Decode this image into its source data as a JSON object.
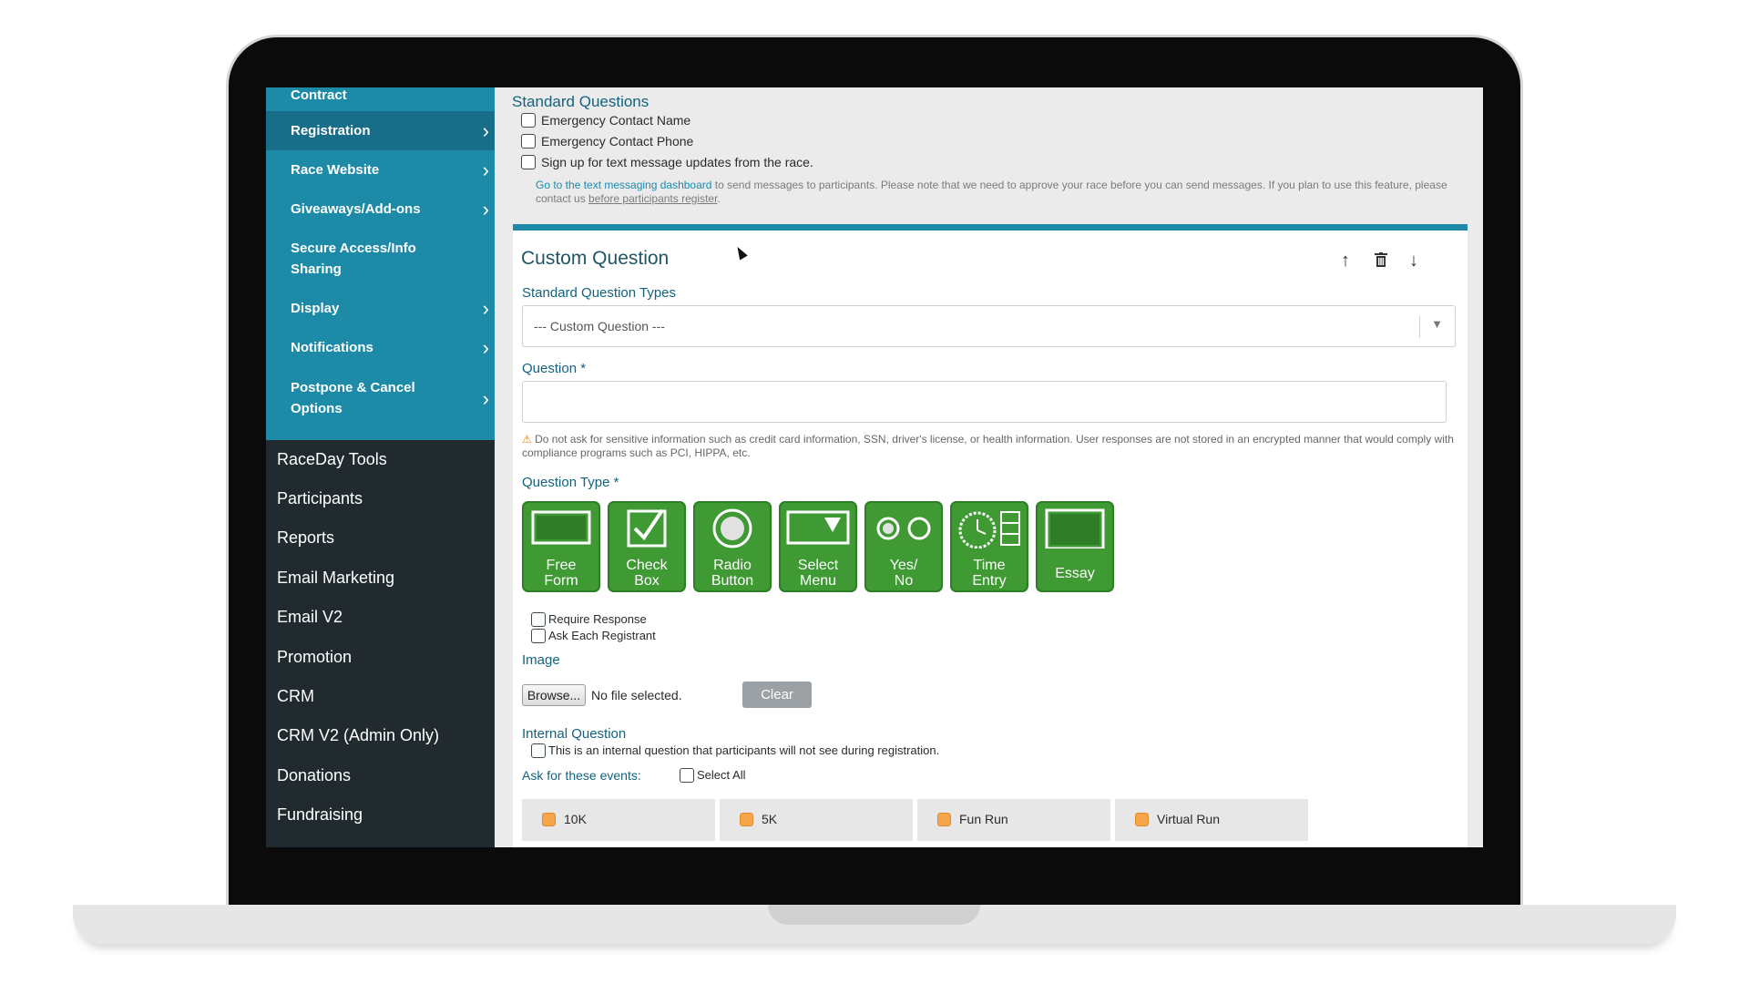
{
  "sidebar": {
    "sub_items": [
      {
        "label": "Contract",
        "chevron": false
      },
      {
        "label": "Registration",
        "chevron": true,
        "active": true
      },
      {
        "label": "Race Website",
        "chevron": true
      },
      {
        "label": "Giveaways/Add-ons",
        "chevron": true
      },
      {
        "label": "Secure Access/Info",
        "label2": "Sharing",
        "chevron": false
      },
      {
        "label": "Display",
        "chevron": true
      },
      {
        "label": "Notifications",
        "chevron": true
      },
      {
        "label": "Postpone & Cancel",
        "label2": "Options",
        "chevron": true
      }
    ],
    "chevron_glyph": "›",
    "main_items": [
      "RaceDay Tools",
      "Participants",
      "Reports",
      "Email Marketing",
      "Email V2",
      "Promotion",
      "CRM",
      "CRM V2 (Admin Only)",
      "Donations",
      "Fundraising"
    ]
  },
  "standard_questions": {
    "title": "Standard Questions",
    "items": [
      "Emergency Contact Name",
      "Emergency Contact Phone",
      "Sign up for text message updates from the race."
    ],
    "note_link": "Go to the text messaging dashboard",
    "note_text": " to send messages to participants. Please note that we need to approve your race before you can send messages. If you plan to use this feature, please contact us ",
    "note_link2": "before participants register",
    "note_end": "."
  },
  "custom_question": {
    "title": "Custom Question",
    "icons": {
      "up": "↑",
      "trash": "🗑",
      "down": "↓"
    },
    "std_types_label": "Standard Question Types",
    "std_types_value": "--- Custom Question ---",
    "select_arrow": "▼",
    "question_label": "Question *",
    "question_value": "",
    "warning_icon": "⚠",
    "warning_text": " Do not ask for sensitive information such as credit card information, SSN, driver's license, or health information. User responses are not stored in an encrypted manner that would comply with compliance programs such as PCI, HIPPA, etc.",
    "question_type_label": "Question Type *",
    "question_types": [
      {
        "line1": "Free",
        "line2": "Form",
        "icon": "free-form-icon"
      },
      {
        "line1": "Check",
        "line2": "Box",
        "icon": "check-box-icon"
      },
      {
        "line1": "Radio",
        "line2": "Button",
        "icon": "radio-button-icon"
      },
      {
        "line1": "Select",
        "line2": "Menu",
        "icon": "select-menu-icon"
      },
      {
        "line1": "Yes/",
        "line2": "No",
        "icon": "yes-no-icon"
      },
      {
        "line1": "Time",
        "line2": "Entry",
        "icon": "time-entry-icon"
      },
      {
        "line1": "Essay",
        "line2": "",
        "icon": "essay-icon"
      }
    ],
    "require_response": "Require Response",
    "ask_each": "Ask Each Registrant",
    "image_label": "Image",
    "browse_label": "Browse...",
    "no_file": "No file selected.",
    "clear_label": "Clear",
    "internal_label": "Internal Question",
    "internal_text": "This is an internal question that participants will not see during registration.",
    "events_label": "Ask for these events:",
    "select_all": "Select All",
    "events": [
      "10K",
      "5K",
      "Fun Run",
      "Virtual Run"
    ]
  },
  "colors": {
    "sidebar_dark": "#212a2f",
    "submenu_teal": "#1d8aa7",
    "submenu_active": "#186d88",
    "button_green": "#3f9a34",
    "heading_teal": "#13627f",
    "event_checkbox": "#f7a54a"
  }
}
